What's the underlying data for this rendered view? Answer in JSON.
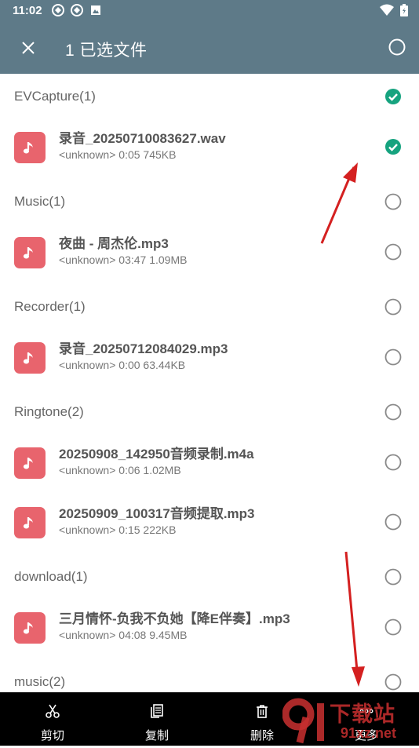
{
  "status": {
    "time": "11:02"
  },
  "appbar": {
    "title": "1 已选文件"
  },
  "groups": [
    {
      "header": "EVCapture(1)",
      "header_checked": true,
      "files": [
        {
          "name": "录音_20250710083627.wav",
          "meta": "<unknown> 0:05 745KB",
          "checked": true
        }
      ]
    },
    {
      "header": "Music(1)",
      "header_checked": false,
      "files": [
        {
          "name": "夜曲 - 周杰伦.mp3",
          "meta": "<unknown> 03:47 1.09MB",
          "checked": false
        }
      ]
    },
    {
      "header": "Recorder(1)",
      "header_checked": false,
      "files": [
        {
          "name": "录音_20250712084029.mp3",
          "meta": "<unknown> 0:00 63.44KB",
          "checked": false
        }
      ]
    },
    {
      "header": "Ringtone(2)",
      "header_checked": false,
      "files": [
        {
          "name": "20250908_142950音频录制.m4a",
          "meta": "<unknown> 0:06 1.02MB",
          "checked": false
        },
        {
          "name": "20250909_100317音频提取.mp3",
          "meta": "<unknown> 0:15 222KB",
          "checked": false
        }
      ]
    },
    {
      "header": "download(1)",
      "header_checked": false,
      "files": [
        {
          "name": "三月情怀-负我不负她【降E伴奏】.mp3",
          "meta": "<unknown> 04:08 9.45MB",
          "checked": false
        }
      ]
    },
    {
      "header": "music(2)",
      "header_checked": false,
      "files": []
    }
  ],
  "bottombar": {
    "cut": "剪切",
    "copy": "复制",
    "delete": "删除",
    "more": "更多"
  },
  "watermark": {
    "text": "下载站",
    "domain": "91xz.net"
  },
  "colors": {
    "accent": "#5e7a88",
    "check": "#16a37f",
    "thumb": "#e8646d",
    "arrow": "#d42020"
  }
}
